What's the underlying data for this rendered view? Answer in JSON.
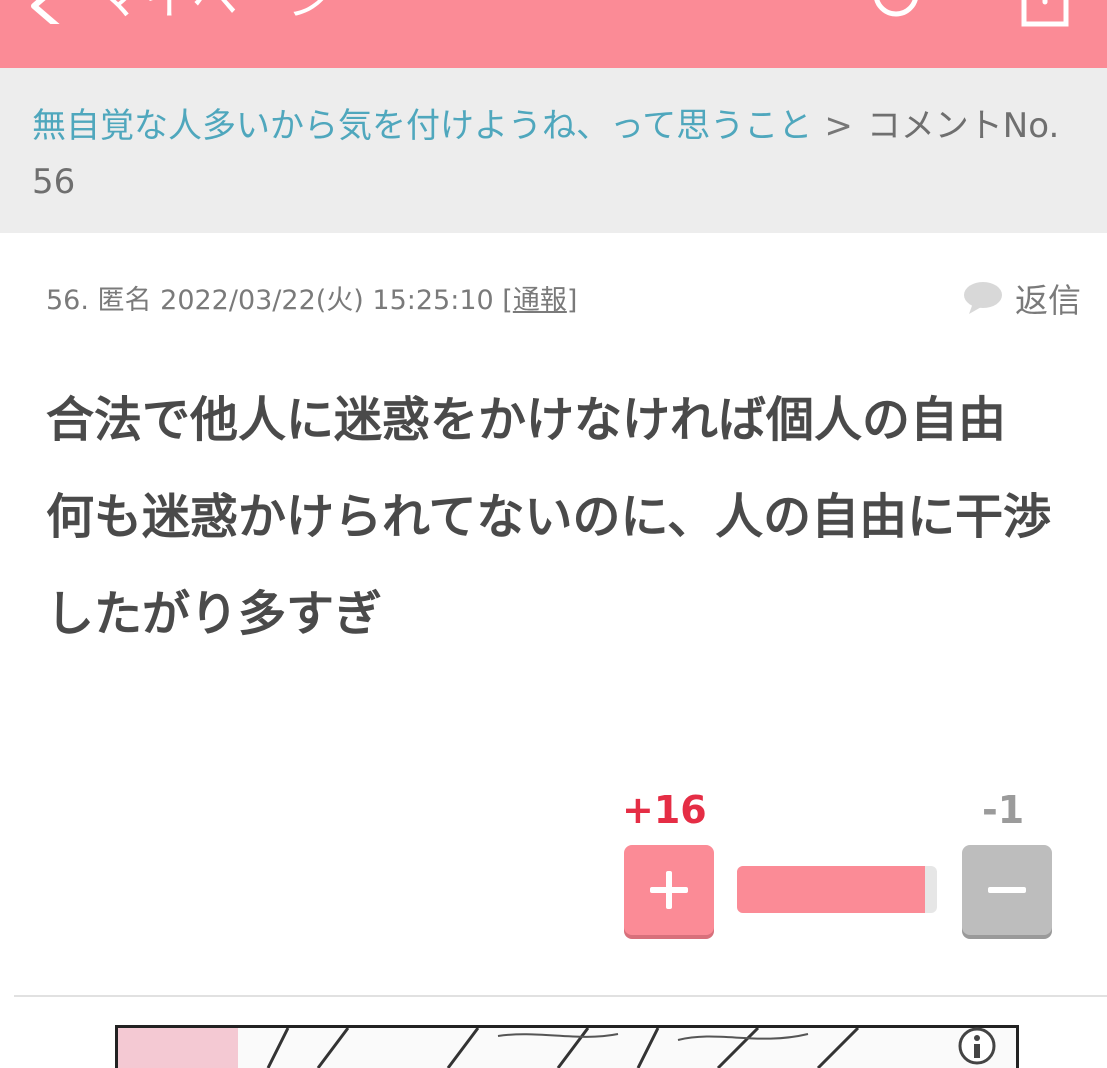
{
  "header": {
    "title": "マイページ",
    "back_icon": "chevron-left-icon",
    "user_icon": "user-icon",
    "share_icon": "share-icon",
    "color": "#fb8b96"
  },
  "breadcrumb": {
    "topic_link": "無自覚な人多いから気を付けようね、って思うこと",
    "separator": ">",
    "current": "コメントNo. 56"
  },
  "comment": {
    "number": "56.",
    "author": "匿名",
    "datetime": "2022/03/22(火) 15:25:10",
    "report_open": "[",
    "report_label": "通報",
    "report_close": "]",
    "reply_label": "返信",
    "body_lines": [
      "合法で他人に迷惑をかけなければ個人の自由",
      "何も迷惑かけられてないのに、人の自由に干渉したがり多すぎ"
    ]
  },
  "votes": {
    "plus": "+16",
    "minus": "-1",
    "plus_ratio": 0.94,
    "plus_color": "#e52d45",
    "minus_color": "#9b9b9b"
  }
}
